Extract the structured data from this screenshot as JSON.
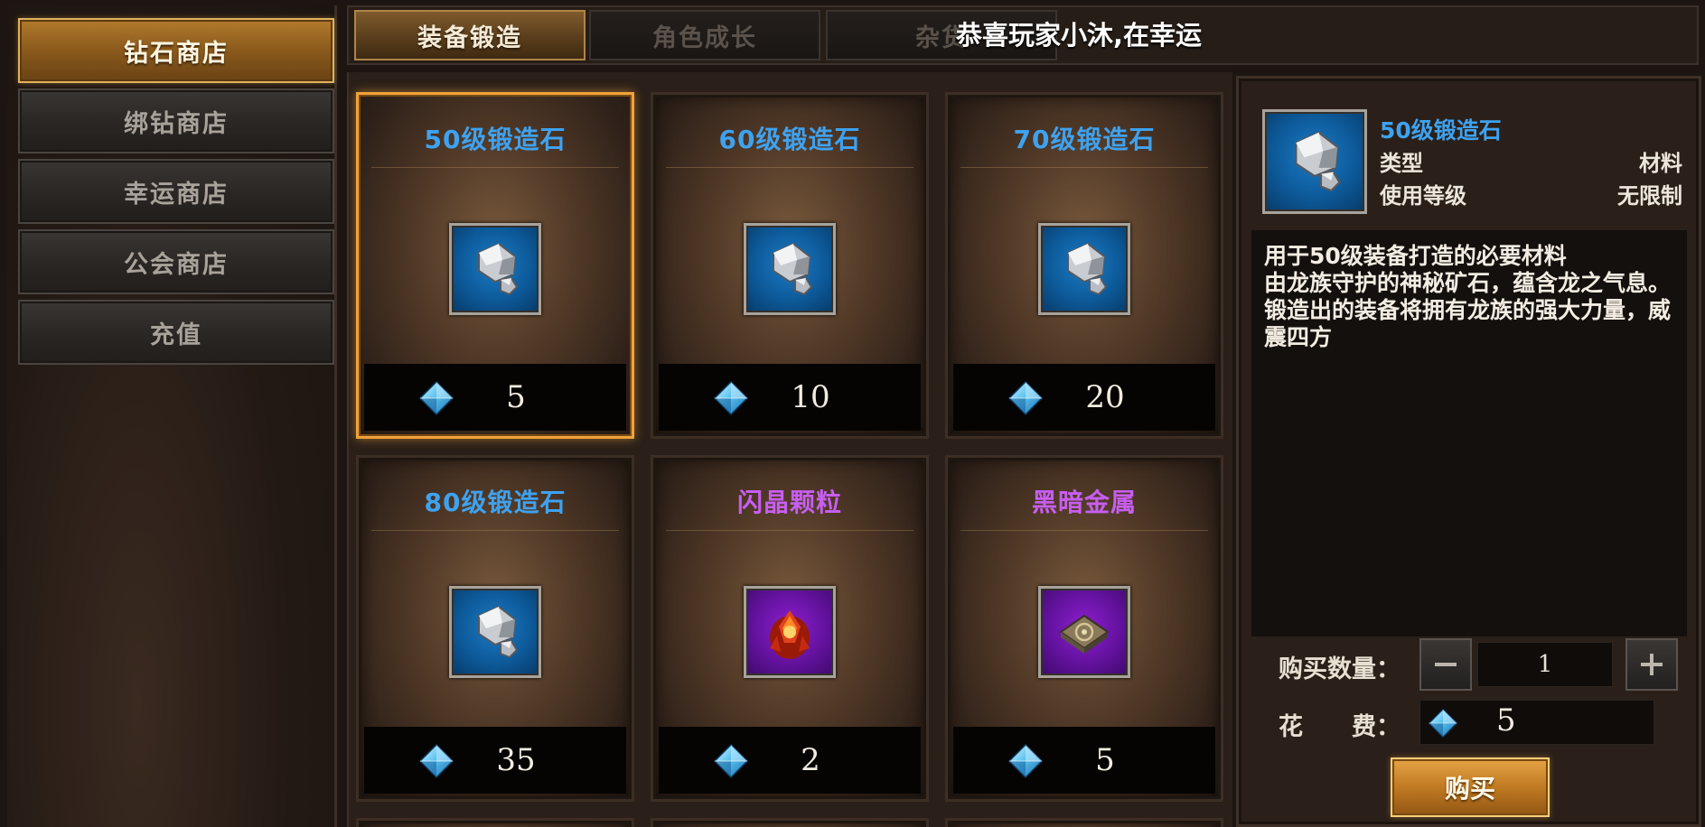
{
  "sidebar": {
    "items": [
      {
        "label": "钻石商店",
        "active": true
      },
      {
        "label": "绑钻商店",
        "active": false
      },
      {
        "label": "幸运商店",
        "active": false
      },
      {
        "label": "公会商店",
        "active": false
      },
      {
        "label": "充值",
        "active": false
      }
    ]
  },
  "tabs": {
    "items": [
      {
        "label": "装备锻造",
        "active": true
      },
      {
        "label": "角色成长",
        "active": false
      },
      {
        "label": "杂货",
        "active": false
      }
    ]
  },
  "announcement": {
    "text": "恭喜玩家小沐,在幸运"
  },
  "items": [
    {
      "name": "50级锻造石",
      "price": "5",
      "name_color": "#3ea2f0",
      "icon": "forge-stone-icon",
      "selected": true
    },
    {
      "name": "60级锻造石",
      "price": "10",
      "name_color": "#3ea2f0",
      "icon": "forge-stone-icon",
      "selected": false
    },
    {
      "name": "70级锻造石",
      "price": "20",
      "name_color": "#3ea2f0",
      "icon": "forge-stone-icon",
      "selected": false
    },
    {
      "name": "80级锻造石",
      "price": "35",
      "name_color": "#3ea2f0",
      "icon": "forge-stone-icon",
      "selected": false
    },
    {
      "name": "闪晶颗粒",
      "price": "2",
      "name_color": "#c75ef0",
      "icon": "crystal-shard-icon",
      "selected": false
    },
    {
      "name": "黑暗金属",
      "price": "5",
      "name_color": "#c75ef0",
      "icon": "dark-metal-icon",
      "selected": false
    }
  ],
  "detail": {
    "name": "50级锻造石",
    "type_label": "类型",
    "type_value": "材料",
    "level_label": "使用等级",
    "level_value": "无限制",
    "description": "用于50级装备打造的必要材料\n由龙族守护的神秘矿石，蕴含龙之气息。锻造出的装备将拥有龙族的强大力量，威震四方",
    "quantity_label": "购买数量：",
    "quantity": "1",
    "cost_label": "花　　费：",
    "cost": "5",
    "buy_label": "购买"
  },
  "colors": {
    "rare_blue": "#3ea2f0",
    "epic_purple": "#c75ef0",
    "accent_gold": "#e6a446"
  }
}
